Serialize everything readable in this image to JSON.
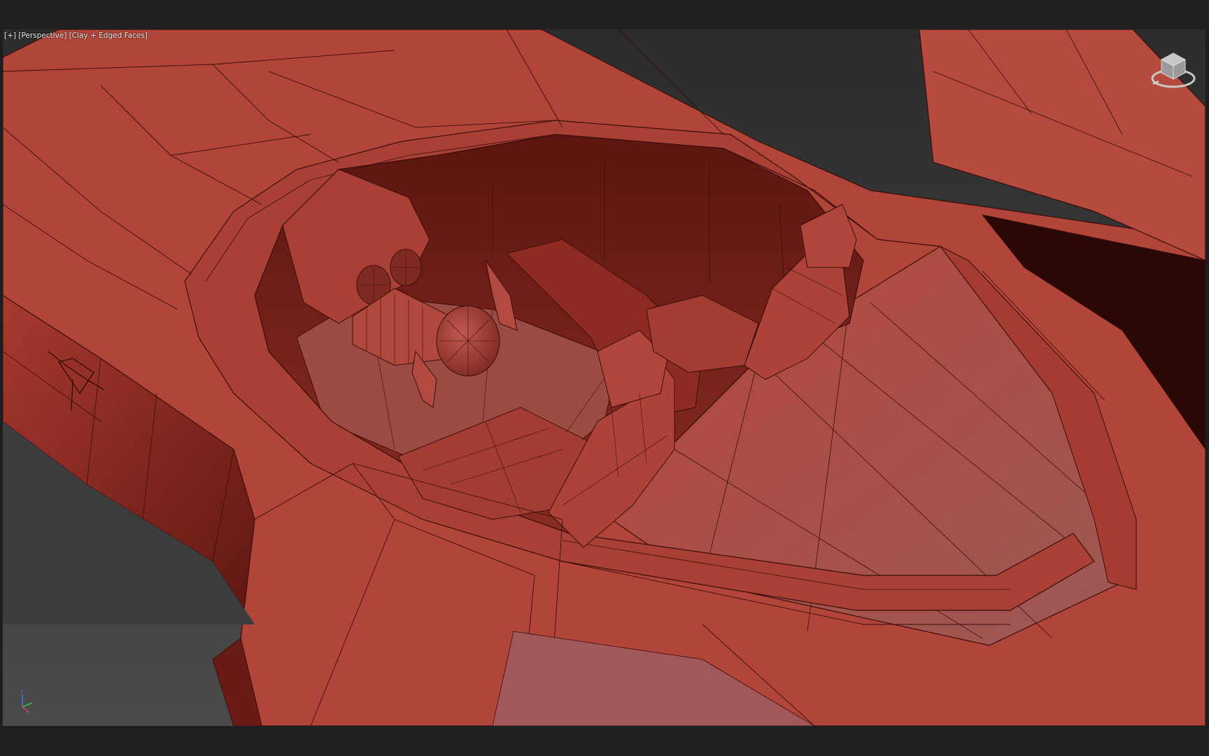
{
  "viewport": {
    "menu_label": "[+]",
    "view_label": "[Perspective]",
    "shading_label": "[Clay + Edged Faces]"
  },
  "colors": {
    "clay_light": "#b94b40",
    "clay_mid": "#a33d33",
    "clay_dark": "#6e1e17",
    "clay_pale": "#a25a57",
    "edge": "#3a0d0a",
    "viewport_bg": "#3a3a3a",
    "frame_bg": "#202020"
  },
  "icons": {
    "viewcube": "viewcube-icon",
    "axis_tripod": "axis-tripod-icon"
  }
}
